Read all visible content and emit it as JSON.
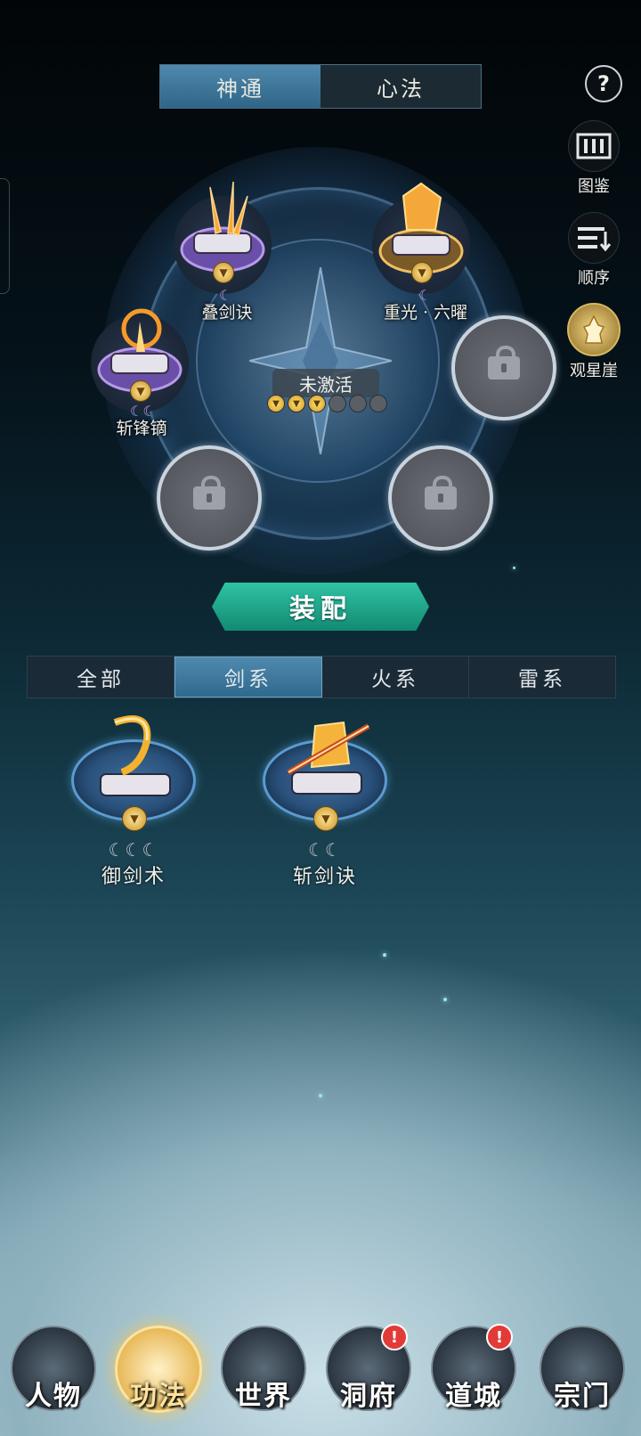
{
  "top_tabs": [
    "神通",
    "心法"
  ],
  "help_label": "?",
  "side_buttons": [
    {
      "label": "图鉴",
      "icon": "codex-icon"
    },
    {
      "label": "顺序",
      "icon": "order-list-icon"
    },
    {
      "label": "观星崖",
      "icon": "star-cliff-icon"
    }
  ],
  "wheel": {
    "center_status": "未激活",
    "active_dots": 3,
    "total_dots": 6,
    "equipped": [
      {
        "name": "叠剑诀",
        "moons": 1
      },
      {
        "name": "重光 · 六曜",
        "moons": 1
      },
      {
        "name": "斩锋镝",
        "moons": 2
      }
    ],
    "locked_slots": 3
  },
  "equip_button": "装配",
  "filter_tabs": [
    "全部",
    "剑系",
    "火系",
    "雷系"
  ],
  "active_filter": "剑系",
  "owned_skills": [
    {
      "name": "御剑术",
      "moons": 3
    },
    {
      "name": "斩剑诀",
      "moons": 2
    }
  ],
  "bottom_nav": [
    {
      "label": "人物",
      "alert": false
    },
    {
      "label": "功法",
      "alert": false,
      "active": true
    },
    {
      "label": "世界",
      "alert": false
    },
    {
      "label": "洞府",
      "alert": true
    },
    {
      "label": "道城",
      "alert": true
    },
    {
      "label": "宗门",
      "alert": false
    }
  ],
  "alert_mark": "!",
  "colors": {
    "accent_blue": "#4f89ad",
    "equip_green": "#2fc3a3",
    "gold": "#e8b95a",
    "alert_red": "#e23a36"
  }
}
